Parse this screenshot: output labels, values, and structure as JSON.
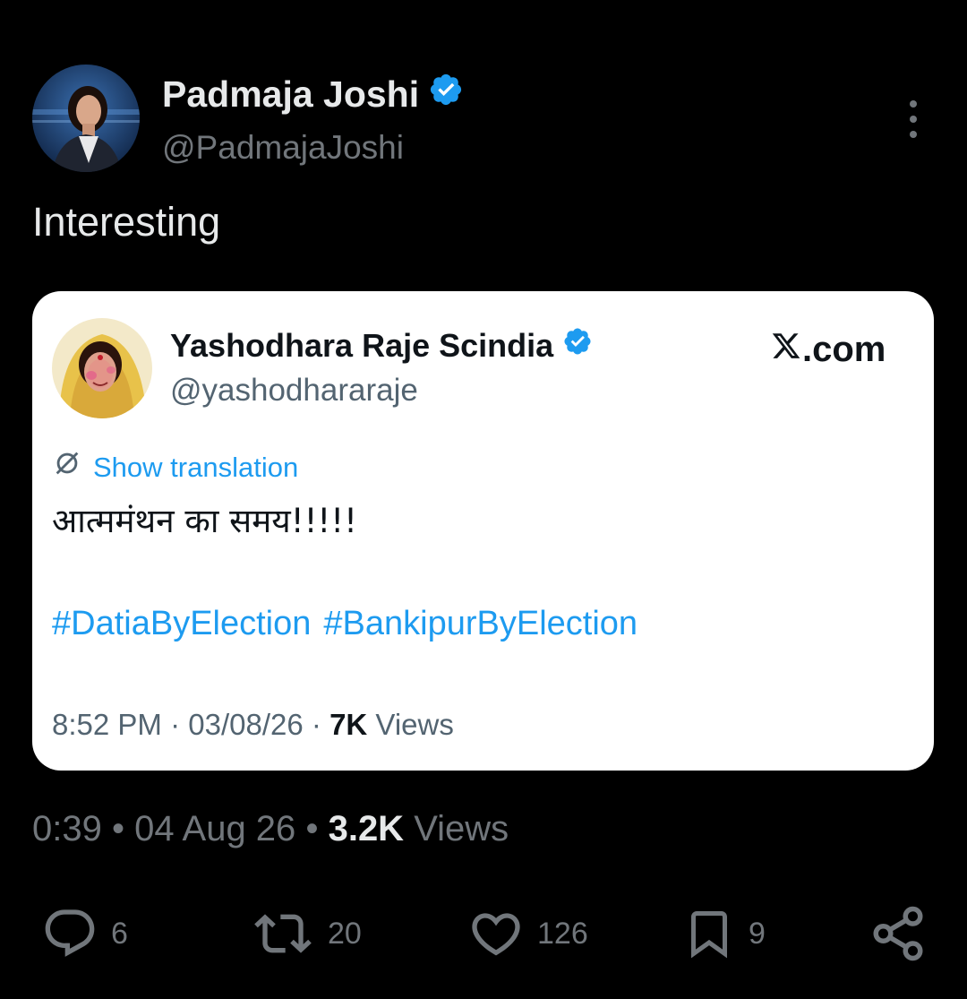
{
  "author": {
    "name": "Padmaja Joshi",
    "handle": "@PadmajaJoshi",
    "verified": true
  },
  "tweet": {
    "text": "Interesting",
    "time": "0:39",
    "date": "04 Aug 26",
    "views_count": "3.2K",
    "views_label": "Views",
    "separator": "•"
  },
  "quoted": {
    "name": "Yashodhara Raje Scindia",
    "handle": "@yashodhararaje",
    "verified": true,
    "source_label": ".com",
    "show_translation": "Show translation",
    "text": "आत्ममंथन का समय!!!!!",
    "hashtags": [
      "#DatiaByElection",
      "#BankipurByElection"
    ],
    "time": "8:52 PM",
    "date": "03/08/26",
    "views_count": "7K",
    "views_label": "Views",
    "separator": "·"
  },
  "actions": {
    "replies": "6",
    "reposts": "20",
    "likes": "126",
    "bookmarks": "9"
  },
  "colors": {
    "background": "#000000",
    "accent": "#1d9bf0",
    "muted": "#71767b",
    "text": "#e7e9ea",
    "card_bg": "#ffffff"
  },
  "icons": [
    "verified-badge-icon",
    "more-icon",
    "translate-icon",
    "x-logo-icon",
    "reply-icon",
    "repost-icon",
    "like-icon",
    "bookmark-icon",
    "share-icon"
  ]
}
